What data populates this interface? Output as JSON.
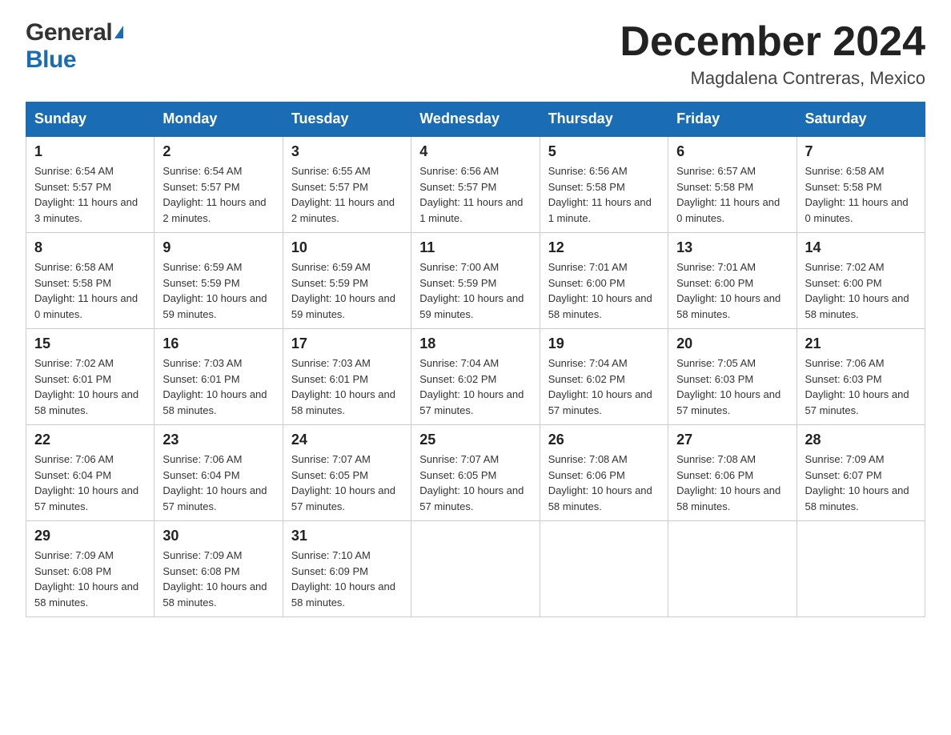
{
  "header": {
    "logo_general": "General",
    "logo_blue": "Blue",
    "title": "December 2024",
    "subtitle": "Magdalena Contreras, Mexico"
  },
  "days_of_week": [
    "Sunday",
    "Monday",
    "Tuesday",
    "Wednesday",
    "Thursday",
    "Friday",
    "Saturday"
  ],
  "weeks": [
    [
      {
        "day": "1",
        "sunrise": "6:54 AM",
        "sunset": "5:57 PM",
        "daylight": "11 hours and 3 minutes."
      },
      {
        "day": "2",
        "sunrise": "6:54 AM",
        "sunset": "5:57 PM",
        "daylight": "11 hours and 2 minutes."
      },
      {
        "day": "3",
        "sunrise": "6:55 AM",
        "sunset": "5:57 PM",
        "daylight": "11 hours and 2 minutes."
      },
      {
        "day": "4",
        "sunrise": "6:56 AM",
        "sunset": "5:57 PM",
        "daylight": "11 hours and 1 minute."
      },
      {
        "day": "5",
        "sunrise": "6:56 AM",
        "sunset": "5:58 PM",
        "daylight": "11 hours and 1 minute."
      },
      {
        "day": "6",
        "sunrise": "6:57 AM",
        "sunset": "5:58 PM",
        "daylight": "11 hours and 0 minutes."
      },
      {
        "day": "7",
        "sunrise": "6:58 AM",
        "sunset": "5:58 PM",
        "daylight": "11 hours and 0 minutes."
      }
    ],
    [
      {
        "day": "8",
        "sunrise": "6:58 AM",
        "sunset": "5:58 PM",
        "daylight": "11 hours and 0 minutes."
      },
      {
        "day": "9",
        "sunrise": "6:59 AM",
        "sunset": "5:59 PM",
        "daylight": "10 hours and 59 minutes."
      },
      {
        "day": "10",
        "sunrise": "6:59 AM",
        "sunset": "5:59 PM",
        "daylight": "10 hours and 59 minutes."
      },
      {
        "day": "11",
        "sunrise": "7:00 AM",
        "sunset": "5:59 PM",
        "daylight": "10 hours and 59 minutes."
      },
      {
        "day": "12",
        "sunrise": "7:01 AM",
        "sunset": "6:00 PM",
        "daylight": "10 hours and 58 minutes."
      },
      {
        "day": "13",
        "sunrise": "7:01 AM",
        "sunset": "6:00 PM",
        "daylight": "10 hours and 58 minutes."
      },
      {
        "day": "14",
        "sunrise": "7:02 AM",
        "sunset": "6:00 PM",
        "daylight": "10 hours and 58 minutes."
      }
    ],
    [
      {
        "day": "15",
        "sunrise": "7:02 AM",
        "sunset": "6:01 PM",
        "daylight": "10 hours and 58 minutes."
      },
      {
        "day": "16",
        "sunrise": "7:03 AM",
        "sunset": "6:01 PM",
        "daylight": "10 hours and 58 minutes."
      },
      {
        "day": "17",
        "sunrise": "7:03 AM",
        "sunset": "6:01 PM",
        "daylight": "10 hours and 58 minutes."
      },
      {
        "day": "18",
        "sunrise": "7:04 AM",
        "sunset": "6:02 PM",
        "daylight": "10 hours and 57 minutes."
      },
      {
        "day": "19",
        "sunrise": "7:04 AM",
        "sunset": "6:02 PM",
        "daylight": "10 hours and 57 minutes."
      },
      {
        "day": "20",
        "sunrise": "7:05 AM",
        "sunset": "6:03 PM",
        "daylight": "10 hours and 57 minutes."
      },
      {
        "day": "21",
        "sunrise": "7:06 AM",
        "sunset": "6:03 PM",
        "daylight": "10 hours and 57 minutes."
      }
    ],
    [
      {
        "day": "22",
        "sunrise": "7:06 AM",
        "sunset": "6:04 PM",
        "daylight": "10 hours and 57 minutes."
      },
      {
        "day": "23",
        "sunrise": "7:06 AM",
        "sunset": "6:04 PM",
        "daylight": "10 hours and 57 minutes."
      },
      {
        "day": "24",
        "sunrise": "7:07 AM",
        "sunset": "6:05 PM",
        "daylight": "10 hours and 57 minutes."
      },
      {
        "day": "25",
        "sunrise": "7:07 AM",
        "sunset": "6:05 PM",
        "daylight": "10 hours and 57 minutes."
      },
      {
        "day": "26",
        "sunrise": "7:08 AM",
        "sunset": "6:06 PM",
        "daylight": "10 hours and 58 minutes."
      },
      {
        "day": "27",
        "sunrise": "7:08 AM",
        "sunset": "6:06 PM",
        "daylight": "10 hours and 58 minutes."
      },
      {
        "day": "28",
        "sunrise": "7:09 AM",
        "sunset": "6:07 PM",
        "daylight": "10 hours and 58 minutes."
      }
    ],
    [
      {
        "day": "29",
        "sunrise": "7:09 AM",
        "sunset": "6:08 PM",
        "daylight": "10 hours and 58 minutes."
      },
      {
        "day": "30",
        "sunrise": "7:09 AM",
        "sunset": "6:08 PM",
        "daylight": "10 hours and 58 minutes."
      },
      {
        "day": "31",
        "sunrise": "7:10 AM",
        "sunset": "6:09 PM",
        "daylight": "10 hours and 58 minutes."
      },
      null,
      null,
      null,
      null
    ]
  ],
  "labels": {
    "sunrise": "Sunrise:",
    "sunset": "Sunset:",
    "daylight": "Daylight:"
  }
}
